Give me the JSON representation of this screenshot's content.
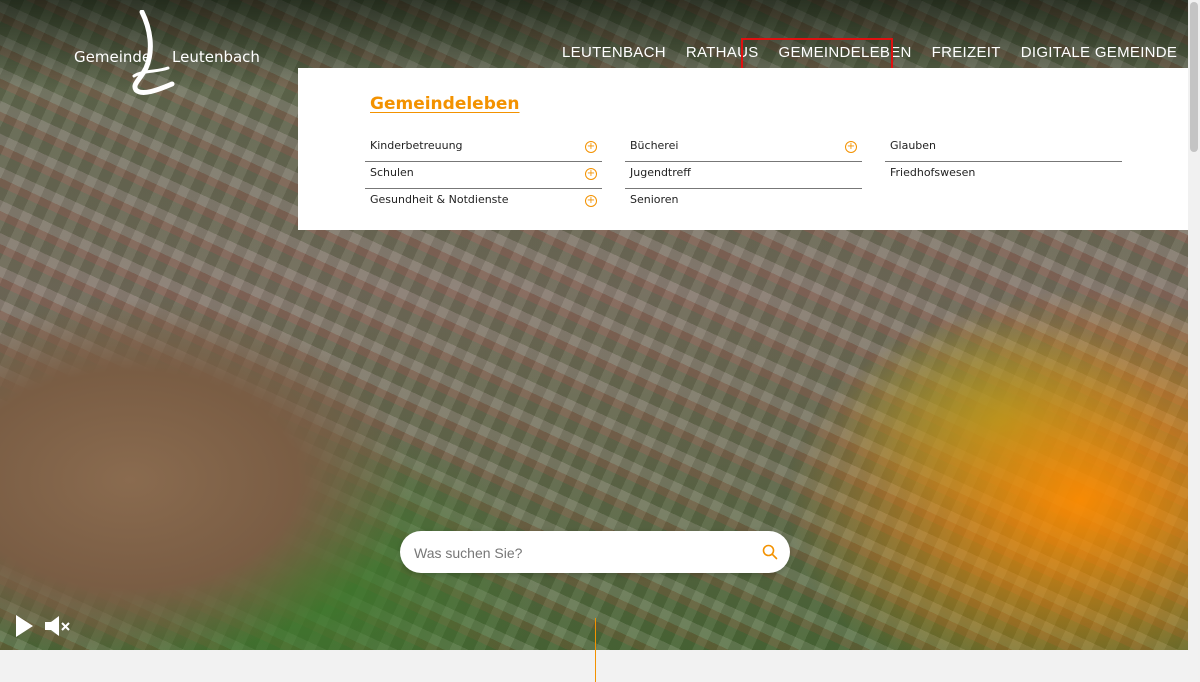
{
  "logo": {
    "left": "Gemeinde",
    "right": "Leutenbach"
  },
  "nav": {
    "items": [
      {
        "label": "LEUTENBACH"
      },
      {
        "label": "RATHAUS"
      },
      {
        "label": "GEMEINDELEBEN"
      },
      {
        "label": "FREIZEIT"
      },
      {
        "label": "DIGITALE GEMEINDE"
      }
    ],
    "active": "GEMEINDELEBEN"
  },
  "mega_menu": {
    "title": "Gemeindeleben",
    "columns": [
      [
        {
          "label": "Kinderbetreuung",
          "expandable": true
        },
        {
          "label": "Schulen",
          "expandable": true
        },
        {
          "label": "Gesundheit & Notdienste",
          "expandable": true
        }
      ],
      [
        {
          "label": "Bücherei",
          "expandable": true
        },
        {
          "label": "Jugendtreff",
          "expandable": false
        },
        {
          "label": "Senioren",
          "expandable": false
        }
      ],
      [
        {
          "label": "Glauben",
          "expandable": false
        },
        {
          "label": "Friedhofswesen",
          "expandable": false
        }
      ]
    ]
  },
  "search": {
    "placeholder": "Was suchen Sie?"
  },
  "colors": {
    "accent": "#f39200",
    "highlight": "#e01010"
  },
  "icons": {
    "play": "play-icon",
    "mute": "mute-icon",
    "search": "search-icon",
    "expand": "plus-circle-icon"
  }
}
